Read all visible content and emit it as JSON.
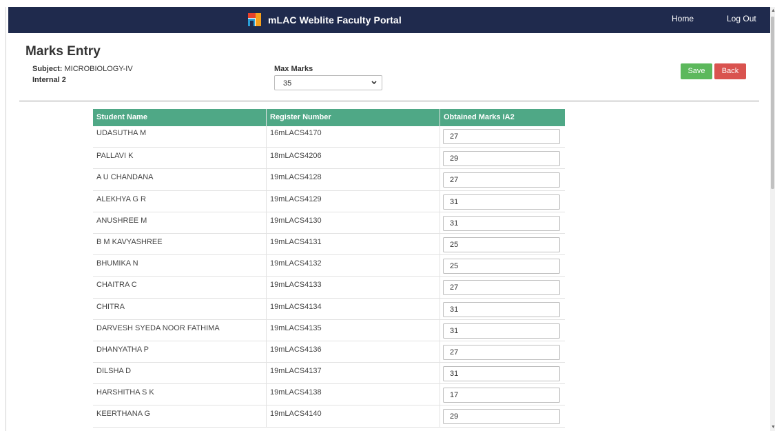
{
  "navbar": {
    "title": "mLAC Weblite Faculty Portal",
    "home": "Home",
    "logout": "Log Out"
  },
  "page": {
    "title": "Marks Entry",
    "subject_label": "Subject:",
    "subject_value": "MICROBIOLOGY-IV",
    "internal": "Internal 2",
    "max_marks_label": "Max Marks",
    "max_marks_value": "35"
  },
  "buttons": {
    "save": "Save",
    "back": "Back"
  },
  "table": {
    "headers": [
      "Student Name",
      "Register Number",
      "Obtained Marks IA2"
    ],
    "rows": [
      {
        "name": "UDASUTHA M",
        "reg": "16mLACS4170",
        "marks": "27"
      },
      {
        "name": "PALLAVI K",
        "reg": "18mLACS4206",
        "marks": "29"
      },
      {
        "name": "A U CHANDANA",
        "reg": "19mLACS4128",
        "marks": "27"
      },
      {
        "name": "ALEKHYA G R",
        "reg": "19mLACS4129",
        "marks": "31"
      },
      {
        "name": "ANUSHREE M",
        "reg": "19mLACS4130",
        "marks": "31"
      },
      {
        "name": "B M KAVYASHREE",
        "reg": "19mLACS4131",
        "marks": "25"
      },
      {
        "name": "BHUMIKA N",
        "reg": "19mLACS4132",
        "marks": "25"
      },
      {
        "name": "CHAITRA C",
        "reg": "19mLACS4133",
        "marks": "27"
      },
      {
        "name": "CHITRA",
        "reg": "19mLACS4134",
        "marks": "31"
      },
      {
        "name": "DARVESH SYEDA NOOR FATHIMA",
        "reg": "19mLACS4135",
        "marks": "31"
      },
      {
        "name": "DHANYATHA P",
        "reg": "19mLACS4136",
        "marks": "27"
      },
      {
        "name": "DILSHA D",
        "reg": "19mLACS4137",
        "marks": "31"
      },
      {
        "name": "HARSHITHA S K",
        "reg": "19mLACS4138",
        "marks": "17"
      },
      {
        "name": "KEERTHANA G",
        "reg": "19mLACS4140",
        "marks": "29"
      }
    ]
  },
  "colors": {
    "navbar": "#1f2a4d",
    "table_header": "#4fa886",
    "save": "#5cb85c",
    "back": "#d9534f"
  },
  "icons": {
    "brand": "mlac-logo-icon",
    "select": "chevron-down-icon"
  }
}
